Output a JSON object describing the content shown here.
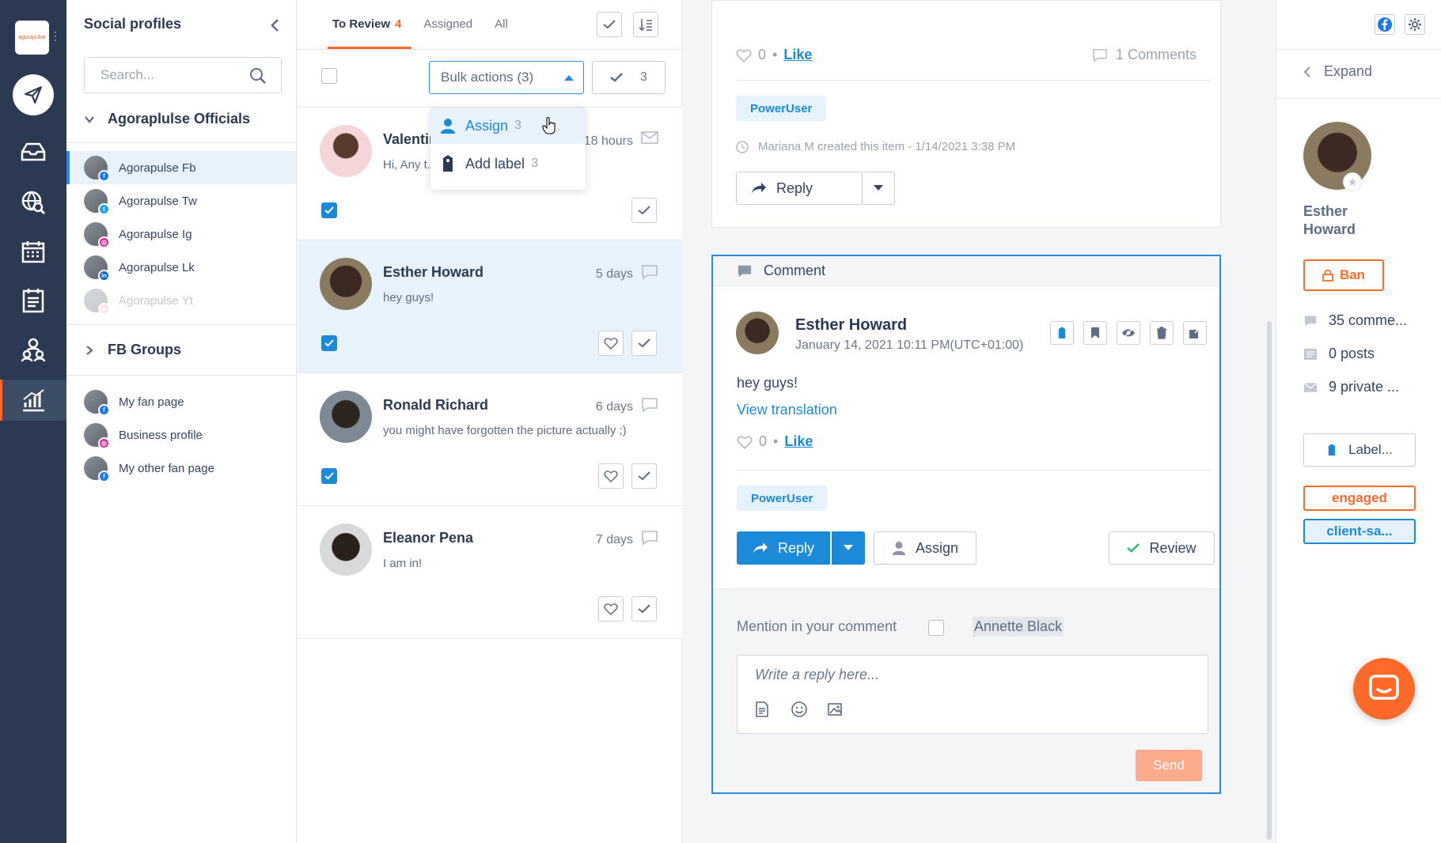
{
  "rail": {
    "logo_text": "agorapulse",
    "icons": [
      "compose-icon",
      "inbox-icon",
      "listening-icon",
      "calendar-icon",
      "publishing-icon",
      "team-icon",
      "reports-icon"
    ]
  },
  "profiles": {
    "title": "Social profiles",
    "search_placeholder": "Search...",
    "group1": {
      "name": "Agoraplulse Officials",
      "items": [
        {
          "label": "Agorapulse Fb",
          "network": "f",
          "color": "#1877f2"
        },
        {
          "label": "Agorapulse Tw",
          "network": "t",
          "color": "#1da1f2"
        },
        {
          "label": "Agorapulse Ig",
          "network": "i",
          "color": "#d6249f"
        },
        {
          "label": "Agorapulse Lk",
          "network": "in",
          "color": "#0a66c2"
        },
        {
          "label": "Agorapulse Yt",
          "network": "y",
          "color": "#ff0000"
        }
      ]
    },
    "group2": {
      "name": "FB Groups"
    },
    "group3": {
      "items": [
        {
          "label": "My fan page",
          "network": "f",
          "color": "#1877f2"
        },
        {
          "label": "Business profile",
          "network": "i",
          "color": "#d6249f"
        },
        {
          "label": "My other fan page",
          "network": "f",
          "color": "#1877f2"
        }
      ]
    }
  },
  "inbox": {
    "tabs": [
      {
        "label": "To Review",
        "count": "4"
      },
      {
        "label": "Assigned"
      },
      {
        "label": "All"
      }
    ],
    "bulk_label": "Bulk actions (3)",
    "selected_count": "3",
    "dropdown": [
      {
        "label": "Assign",
        "count": "3"
      },
      {
        "label": "Add label",
        "count": "3"
      }
    ],
    "items": [
      {
        "name": "Valentina",
        "time": "18 hours",
        "text": "Hi, Any t... ...ue Monday?"
      },
      {
        "name": "Esther Howard",
        "time": "5 days",
        "text": "hey guys!"
      },
      {
        "name": "Ronald Richard",
        "time": "6 days",
        "text": "you might have forgotten the picture actually ;)"
      },
      {
        "name": "Eleanor Pena",
        "time": "7 days",
        "text": "I am in!"
      }
    ]
  },
  "detail": {
    "top": {
      "likes": "0",
      "like_label": "Like",
      "comments": "1 Comments",
      "tag": "PowerUser",
      "created": "Mariana M created this item - 1/14/2021 3:38 PM",
      "reply_label": "Reply"
    },
    "comment": {
      "header": "Comment",
      "author": "Esther Howard",
      "date": "January 14, 2021 10:11 PM(UTC+01:00)",
      "text": "hey guys!",
      "translation": "View translation",
      "likes": "0",
      "like_label": "Like",
      "tag": "PowerUser",
      "reply_label": "Reply",
      "assign_label": "Assign",
      "review_label": "Review",
      "mention_label": "Mention in your comment",
      "mention_name": "Annette Black",
      "reply_placeholder": "Write a reply here...",
      "send_label": "Send"
    }
  },
  "side": {
    "expand_label": "Expand",
    "name_first": "Esther",
    "name_last": "Howard",
    "ban_label": "Ban",
    "stats": [
      "35 comme...",
      "0 posts",
      "9 private ..."
    ],
    "label_button": "Label...",
    "labels": [
      {
        "text": "engaged",
        "color": "#ff6a2b"
      },
      {
        "text": "client-sa...",
        "color": "#1b8ad9"
      }
    ]
  },
  "colors": {
    "accent": "#ff6a2b",
    "primary": "#1b8ad9",
    "rail": "#2b3a52"
  }
}
